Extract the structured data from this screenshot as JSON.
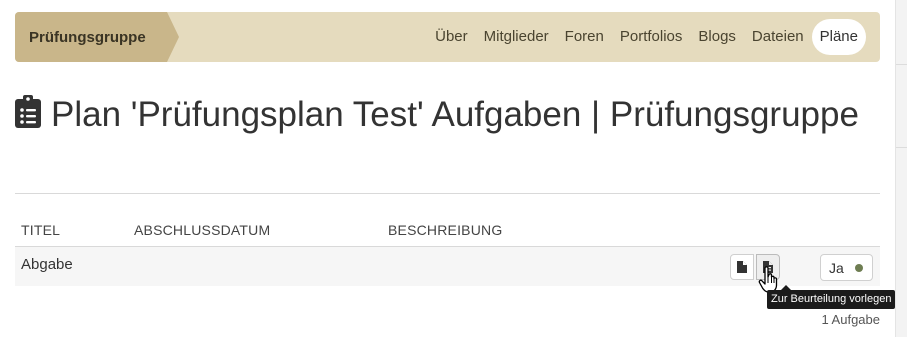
{
  "group_nav": {
    "group_name": "Prüfungsgruppe",
    "tabs": [
      {
        "label": "Über"
      },
      {
        "label": "Mitglieder"
      },
      {
        "label": "Foren"
      },
      {
        "label": "Portfolios"
      },
      {
        "label": "Blogs"
      },
      {
        "label": "Dateien"
      },
      {
        "label": "Pläne",
        "active": true
      }
    ]
  },
  "page": {
    "title_icon": "clipboard-list-icon",
    "title": "Plan 'Prüfungsplan Test' Aufgaben | Prüfungsgruppe"
  },
  "table": {
    "columns": [
      "TITEL",
      "ABSCHLUSSDATUM",
      "BESCHREIBUNG"
    ],
    "rows": [
      {
        "title": "Abgabe",
        "date": "",
        "description": "",
        "actions": [
          {
            "icon": "file-icon"
          },
          {
            "icon": "file-submit-icon",
            "tooltip": "Zur Beurteilung vorlegen"
          }
        ],
        "status": "Ja"
      }
    ],
    "count": "1 Aufgabe"
  },
  "colors": {
    "nav_bg": "#e5dbbe",
    "group_name_bg": "#c9b68a",
    "status_dot": "#6e7d52"
  }
}
